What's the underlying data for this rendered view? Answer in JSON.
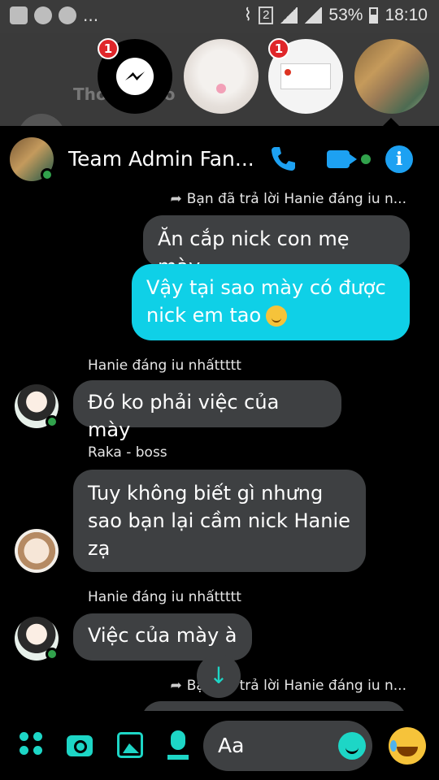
{
  "status_bar": {
    "dots": "...",
    "sim_slot": "2",
    "battery": "53%",
    "time": "18:10"
  },
  "chat_heads": {
    "messenger_badge": "1",
    "page_badge": "1",
    "backdrop_name": "Thơ TooToo"
  },
  "header": {
    "title": "Team Admin Fan..."
  },
  "messages": [
    {
      "type": "reply-note",
      "text": "Bạn đã trả lời Hanie đáng iu n..."
    },
    {
      "type": "outgoing",
      "style": "gray",
      "text": "Ăn cắp nick con mẹ mày"
    },
    {
      "type": "outgoing",
      "style": "cyan",
      "text": "Vậy tại sao mày có được nick em tao",
      "emoji": "slightly-smiling-face"
    },
    {
      "type": "sender",
      "text": "Hanie đáng iu nhấttttt"
    },
    {
      "type": "incoming",
      "text": "Đó ko phải việc của mày"
    },
    {
      "type": "sender",
      "text": "Raka - boss"
    },
    {
      "type": "incoming",
      "text": "Tuy không biết gì nhưng sao bạn lại cầm nick Hanie zạ"
    },
    {
      "type": "sender",
      "text": "Hanie đáng iu nhấttttt"
    },
    {
      "type": "incoming",
      "text": "Việc của mày à"
    },
    {
      "type": "reply-note",
      "text": "Bạn đã trả lời Hanie đáng iu n..."
    }
  ],
  "composer": {
    "placeholder": "Aa"
  },
  "colors": {
    "accent": "#1dd6c6",
    "outgoing_bubble": "#0fd0e7",
    "incoming_bubble": "#3e4042",
    "info_blue": "#1da1f2",
    "online_green": "#31a24c",
    "badge_red": "#e0262a"
  },
  "icons": [
    "messenger-icon",
    "phone-icon",
    "video-icon",
    "info-icon",
    "reply-arrow-icon",
    "scroll-down-icon",
    "apps-icon",
    "camera-icon",
    "image-icon",
    "mic-icon",
    "emoji-icon",
    "laughing-emoji-icon"
  ]
}
